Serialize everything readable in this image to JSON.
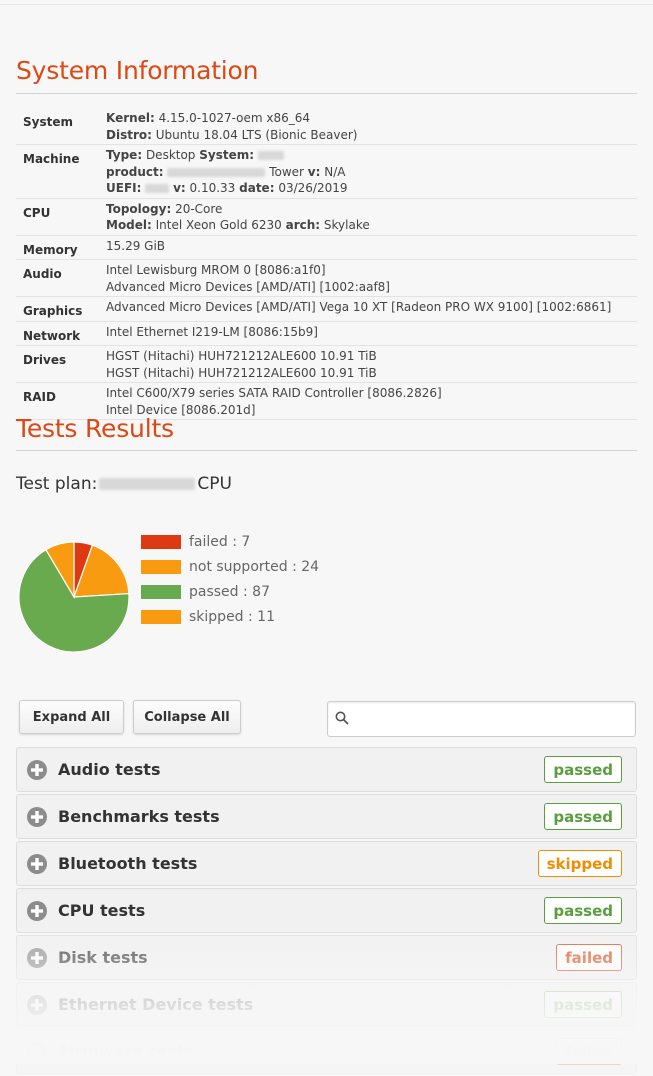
{
  "sections": {
    "system_title": "System Information",
    "tests_title": "Tests Results"
  },
  "system": {
    "rows": [
      {
        "key": "System",
        "lines": [
          [
            {
              "t": "Kernel:",
              "b": true
            },
            {
              "t": " 4.15.0-1027-oem x86_64"
            }
          ],
          [
            {
              "t": "Distro:",
              "b": true
            },
            {
              "t": " Ubuntu 18.04 LTS (Bionic Beaver)"
            }
          ]
        ]
      },
      {
        "key": "Machine",
        "lines": [
          [
            {
              "t": "Type:",
              "b": true
            },
            {
              "t": " Desktop "
            },
            {
              "t": "System:",
              "b": true
            },
            {
              "t": " "
            },
            {
              "blur": 26
            }
          ],
          [
            {
              "t": "product:",
              "b": true
            },
            {
              "t": " "
            },
            {
              "blur": 98
            },
            {
              "t": " Tower "
            },
            {
              "t": "v:",
              "b": true
            },
            {
              "t": " N/A"
            }
          ],
          [
            {
              "t": "UEFI:",
              "b": true
            },
            {
              "t": " "
            },
            {
              "blur": 24
            },
            {
              "t": " "
            },
            {
              "t": "v:",
              "b": true
            },
            {
              "t": " 0.10.33 "
            },
            {
              "t": "date:",
              "b": true
            },
            {
              "t": " 03/26/2019"
            }
          ]
        ]
      },
      {
        "key": "CPU",
        "lines": [
          [
            {
              "t": "Topology:",
              "b": true
            },
            {
              "t": " 20-Core"
            }
          ],
          [
            {
              "t": "Model:",
              "b": true
            },
            {
              "t": " Intel Xeon Gold 6230 "
            },
            {
              "t": "arch:",
              "b": true
            },
            {
              "t": " Skylake"
            }
          ]
        ]
      },
      {
        "key": "Memory",
        "lines": [
          [
            {
              "t": "15.29 GiB"
            }
          ]
        ]
      },
      {
        "key": "Audio",
        "lines": [
          [
            {
              "t": "Intel Lewisburg MROM 0 [8086:a1f0]"
            }
          ],
          [
            {
              "t": "Advanced Micro Devices [AMD/ATI] [1002:aaf8]"
            }
          ]
        ]
      },
      {
        "key": "Graphics",
        "lines": [
          [
            {
              "t": "Advanced Micro Devices [AMD/ATI] Vega 10 XT [Radeon PRO WX 9100] [1002:6861]"
            }
          ]
        ]
      },
      {
        "key": "Network",
        "lines": [
          [
            {
              "t": "Intel Ethernet I219-LM [8086:15b9]"
            }
          ]
        ]
      },
      {
        "key": "Drives",
        "lines": [
          [
            {
              "t": "HGST (Hitachi) HUH721212ALE600 10.91 TiB"
            }
          ],
          [
            {
              "t": "HGST (Hitachi) HUH721212ALE600 10.91 TiB"
            }
          ]
        ]
      },
      {
        "key": "RAID",
        "lines": [
          [
            {
              "t": "Intel C600/X79 series SATA RAID Controller [8086.2826]"
            }
          ],
          [
            {
              "t": "Intel Device [8086.201d]"
            }
          ]
        ]
      }
    ]
  },
  "test_plan": {
    "label": "Test plan:",
    "suffix": "CPU"
  },
  "chart_data": {
    "type": "pie",
    "slices": [
      {
        "label": "failed",
        "value": 7,
        "color": "#dd3a14"
      },
      {
        "label": "not supported",
        "value": 24,
        "color": "#f99b11"
      },
      {
        "label": "passed",
        "value": 87,
        "color": "#6aaa4e"
      },
      {
        "label": "skipped",
        "value": 11,
        "color": "#f99b11"
      }
    ],
    "legend": [
      "failed : 7",
      "not supported : 24",
      "passed : 87",
      "skipped : 11"
    ],
    "legend_position": "right"
  },
  "controls": {
    "expand_all": "Expand All",
    "collapse_all": "Collapse All",
    "search_placeholder": ""
  },
  "tests": [
    {
      "name": "Audio tests",
      "status": "passed",
      "opacity": 1
    },
    {
      "name": "Benchmarks tests",
      "status": "passed",
      "opacity": 1
    },
    {
      "name": "Bluetooth tests",
      "status": "skipped",
      "opacity": 1
    },
    {
      "name": "CPU tests",
      "status": "passed",
      "opacity": 1
    },
    {
      "name": "Disk tests",
      "status": "failed",
      "opacity": 0.85
    },
    {
      "name": "Ethernet Device tests",
      "status": "passed",
      "opacity": 0.5
    },
    {
      "name": "Firmware tests",
      "status": "failed",
      "opacity": 0.2
    }
  ],
  "status_colors": {
    "passed": "#5a9e3e",
    "skipped": "#f28c00",
    "failed": "#dd4814"
  }
}
